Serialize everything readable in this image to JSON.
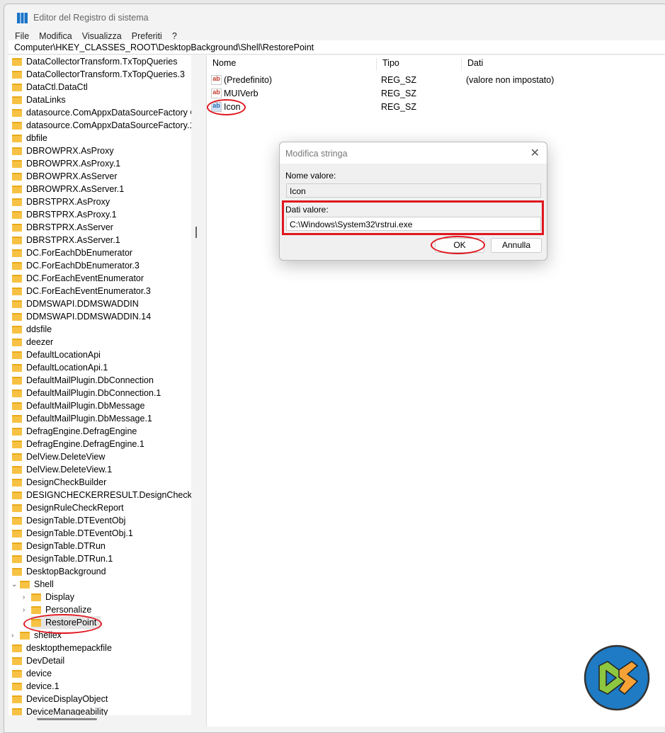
{
  "window": {
    "title": "Editor del Registro di sistema"
  },
  "menu": [
    "File",
    "Modifica",
    "Visualizza",
    "Preferiti",
    "?"
  ],
  "address": "Computer\\HKEY_CLASSES_ROOT\\DesktopBackground\\Shell\\RestorePoint",
  "tree": [
    {
      "label": "DataCollectorTransform.TxTopQueries",
      "level": 0
    },
    {
      "label": "DataCollectorTransform.TxTopQueries.3",
      "level": 0
    },
    {
      "label": "DataCtl.DataCtl",
      "level": 0
    },
    {
      "label": "DataLinks",
      "level": 0
    },
    {
      "label": "datasource.ComAppxDataSourceFactory Cla",
      "level": 0
    },
    {
      "label": "datasource.ComAppxDataSourceFactory.1",
      "level": 0
    },
    {
      "label": "dbfile",
      "level": 0
    },
    {
      "label": "DBROWPRX.AsProxy",
      "level": 0
    },
    {
      "label": "DBROWPRX.AsProxy.1",
      "level": 0
    },
    {
      "label": "DBROWPRX.AsServer",
      "level": 0
    },
    {
      "label": "DBROWPRX.AsServer.1",
      "level": 0
    },
    {
      "label": "DBRSTPRX.AsProxy",
      "level": 0
    },
    {
      "label": "DBRSTPRX.AsProxy.1",
      "level": 0
    },
    {
      "label": "DBRSTPRX.AsServer",
      "level": 0
    },
    {
      "label": "DBRSTPRX.AsServer.1",
      "level": 0
    },
    {
      "label": "DC.ForEachDbEnumerator",
      "level": 0
    },
    {
      "label": "DC.ForEachDbEnumerator.3",
      "level": 0
    },
    {
      "label": "DC.ForEachEventEnumerator",
      "level": 0
    },
    {
      "label": "DC.ForEachEventEnumerator.3",
      "level": 0
    },
    {
      "label": "DDMSWAPI.DDMSWADDIN",
      "level": 0
    },
    {
      "label": "DDMSWAPI.DDMSWADDIN.14",
      "level": 0
    },
    {
      "label": "ddsfile",
      "level": 0
    },
    {
      "label": "deezer",
      "level": 0
    },
    {
      "label": "DefaultLocationApi",
      "level": 0
    },
    {
      "label": "DefaultLocationApi.1",
      "level": 0
    },
    {
      "label": "DefaultMailPlugin.DbConnection",
      "level": 0
    },
    {
      "label": "DefaultMailPlugin.DbConnection.1",
      "level": 0
    },
    {
      "label": "DefaultMailPlugin.DbMessage",
      "level": 0
    },
    {
      "label": "DefaultMailPlugin.DbMessage.1",
      "level": 0
    },
    {
      "label": "DefragEngine.DefragEngine",
      "level": 0
    },
    {
      "label": "DefragEngine.DefragEngine.1",
      "level": 0
    },
    {
      "label": "DelView.DeleteView",
      "level": 0
    },
    {
      "label": "DelView.DeleteView.1",
      "level": 0
    },
    {
      "label": "DesignCheckBuilder",
      "level": 0
    },
    {
      "label": "DESIGNCHECKERRESULT.DesignCheckerResu",
      "level": 0
    },
    {
      "label": "DesignRuleCheckReport",
      "level": 0
    },
    {
      "label": "DesignTable.DTEventObj",
      "level": 0
    },
    {
      "label": "DesignTable.DTEventObj.1",
      "level": 0
    },
    {
      "label": "DesignTable.DTRun",
      "level": 0
    },
    {
      "label": "DesignTable.DTRun.1",
      "level": 0
    },
    {
      "label": "DesktopBackground",
      "level": 0
    },
    {
      "label": "Shell",
      "level": 1,
      "chevron": "v"
    },
    {
      "label": "Display",
      "level": 2,
      "chevron": ">"
    },
    {
      "label": "Personalize",
      "level": 2,
      "chevron": ">"
    },
    {
      "label": "RestorePoint",
      "level": 2,
      "selected": true
    },
    {
      "label": "shellex",
      "level": 1,
      "chevron": ">"
    },
    {
      "label": "desktopthemepackfile",
      "level": 0
    },
    {
      "label": "DevDetail",
      "level": 0
    },
    {
      "label": "device",
      "level": 0
    },
    {
      "label": "device.1",
      "level": 0
    },
    {
      "label": "DeviceDisplayObject",
      "level": 0
    },
    {
      "label": "DeviceManageability",
      "level": 0
    }
  ],
  "columns": [
    "Nome",
    "Tipo",
    "Dati"
  ],
  "values": [
    {
      "name": "(Predefinito)",
      "type": "REG_SZ",
      "data": "(valore non impostato)"
    },
    {
      "name": "MUIVerb",
      "type": "REG_SZ",
      "data": ""
    },
    {
      "name": "Icon",
      "type": "REG_SZ",
      "data": ""
    }
  ],
  "dialog": {
    "title": "Modifica stringa",
    "name_label": "Nome valore:",
    "name_value": "Icon",
    "data_label": "Dati valore:",
    "data_value": "C:\\Windows\\System32\\rstrui.exe",
    "ok": "OK",
    "cancel": "Annulla"
  },
  "colors": {
    "highlight": "#e0171f",
    "logo_bg": "#1e7bc4",
    "logo_green": "#8dc63f",
    "logo_orange": "#f7a236"
  }
}
